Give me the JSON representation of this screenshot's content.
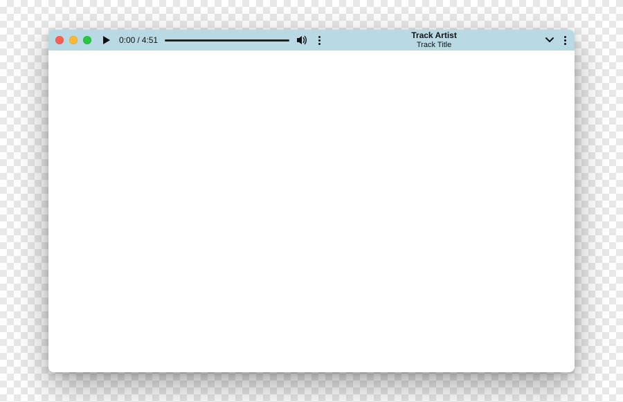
{
  "player": {
    "current_time": "0:00",
    "separator": "/",
    "duration": "4:51"
  },
  "track": {
    "artist": "Track Artist",
    "title": "Track Title"
  }
}
